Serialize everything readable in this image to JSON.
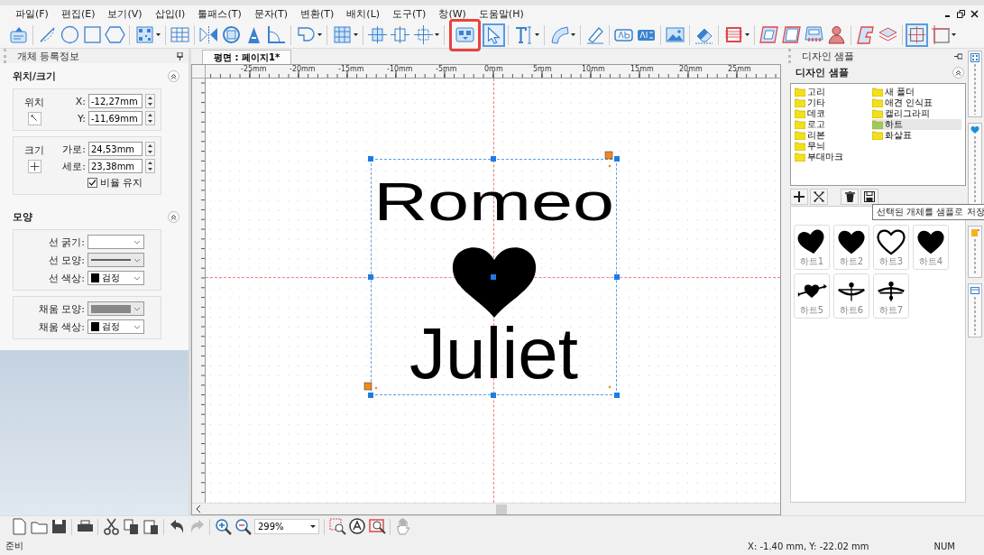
{
  "menu": [
    "파일(F)",
    "편집(E)",
    "보기(V)",
    "삽입(I)",
    "툴패스(T)",
    "문자(T)",
    "변환(T)",
    "배치(L)",
    "도구(T)",
    "창(W)",
    "도움말(H)"
  ],
  "toolbar": [
    {
      "kind": "svg-import",
      "selected": false
    },
    {
      "kind": "separator"
    },
    {
      "kind": "line",
      "selected": false
    },
    {
      "kind": "ellipse",
      "selected": false
    },
    {
      "kind": "rectangle",
      "selected": false
    },
    {
      "kind": "hexagon",
      "selected": false
    },
    {
      "kind": "separator"
    },
    {
      "kind": "qr-code",
      "selected": false,
      "dropdown": true
    },
    {
      "kind": "separator"
    },
    {
      "kind": "table",
      "selected": false
    },
    {
      "kind": "separator"
    },
    {
      "kind": "mirror",
      "selected": false
    },
    {
      "kind": "rotate",
      "selected": false
    },
    {
      "kind": "letter-frame",
      "selected": false
    },
    {
      "kind": "angle",
      "selected": false
    },
    {
      "kind": "separator"
    },
    {
      "kind": "shape",
      "selected": false,
      "dropdown": true
    },
    {
      "kind": "separator"
    },
    {
      "kind": "columns",
      "selected": false,
      "dropdown": true
    },
    {
      "kind": "separator"
    },
    {
      "kind": "align-horizontal",
      "selected": false
    },
    {
      "kind": "align-vertical",
      "selected": false
    },
    {
      "kind": "align-center",
      "selected": false,
      "dropdown": true
    },
    {
      "kind": "separator"
    },
    {
      "kind": "group",
      "selected": false,
      "highlighted": true
    },
    {
      "kind": "pointer",
      "selected": true
    },
    {
      "kind": "separator"
    },
    {
      "kind": "text-cursor",
      "selected": false,
      "dropdown": true
    },
    {
      "kind": "separator"
    },
    {
      "kind": "arc-text",
      "selected": false,
      "dropdown": true
    },
    {
      "kind": "separator"
    },
    {
      "kind": "pen",
      "selected": false
    },
    {
      "kind": "separator"
    },
    {
      "kind": "outline-text",
      "selected": false
    },
    {
      "kind": "fill-text",
      "selected": false
    },
    {
      "kind": "separator"
    },
    {
      "kind": "image",
      "selected": false
    },
    {
      "kind": "separator"
    },
    {
      "kind": "eraser",
      "selected": false
    },
    {
      "kind": "separator"
    },
    {
      "kind": "hatch-frame",
      "selected": false,
      "dropdown": true
    },
    {
      "kind": "separator"
    },
    {
      "kind": "frame-thick",
      "selected": false
    },
    {
      "kind": "frame-thin",
      "selected": false
    },
    {
      "kind": "machine",
      "selected": false
    },
    {
      "kind": "figure",
      "selected": false
    },
    {
      "kind": "separator"
    },
    {
      "kind": "cut-shape",
      "selected": false
    },
    {
      "kind": "layers",
      "selected": false
    },
    {
      "kind": "separator"
    },
    {
      "kind": "crosshair",
      "selected": true
    },
    {
      "kind": "border",
      "selected": false,
      "dropdown": true
    }
  ],
  "properties": {
    "title": "개체 등록정보",
    "position_size": {
      "title": "위치/크기",
      "expanded": true,
      "position": {
        "label": "위치",
        "x_label": "X:",
        "x": "-12,27mm",
        "y_label": "Y:",
        "y": "-11,69mm"
      },
      "size": {
        "label": "크기",
        "width_label": "가로:",
        "width": "24,53mm",
        "height_label": "세로:",
        "height": "23,38mm",
        "keep_ratio": {
          "label": "비율 유지",
          "checked": true
        }
      }
    },
    "shape": {
      "title": "모양",
      "expanded": true,
      "line_width": {
        "label": "선 굵기:"
      },
      "line_style": {
        "label": "선 모양:"
      },
      "line_color": {
        "label": "선 색상:",
        "value": "검정"
      },
      "fill_style": {
        "label": "채움 모양:"
      },
      "fill_color": {
        "label": "채움 색상:",
        "value": "검정"
      }
    }
  },
  "document_tab": {
    "label": "평면 : 페이지1*",
    "selected": true
  },
  "ruler": {
    "labels": [
      "-25mm",
      "-20mm",
      "-15mm",
      "-10mm",
      "-5mm",
      "0mm",
      "5mm",
      "10mm",
      "15mm",
      "20mm",
      "25mm"
    ]
  },
  "canvas": {
    "objects": [
      {
        "kind": "text",
        "text": "Romeo"
      },
      {
        "kind": "heart"
      },
      {
        "kind": "text",
        "text": "Juliet"
      }
    ]
  },
  "samples": {
    "title": "디자인 샘플",
    "section": "디자인 샘플",
    "folders": [
      {
        "label": "고리",
        "selected": false
      },
      {
        "label": "기타",
        "selected": false
      },
      {
        "label": "데코",
        "selected": false
      },
      {
        "label": "로고",
        "selected": false
      },
      {
        "label": "리본",
        "selected": false
      },
      {
        "label": "무늬",
        "selected": false
      },
      {
        "label": "부대마크",
        "selected": false
      },
      {
        "label": "새 폴더",
        "selected": false
      },
      {
        "label": "애견 인식표",
        "selected": false
      },
      {
        "label": "캘리그라피",
        "selected": false
      },
      {
        "label": "하트",
        "selected": true
      },
      {
        "label": "화살표",
        "selected": false
      }
    ],
    "items": [
      {
        "label": "하트1",
        "kind": "tilted-heart"
      },
      {
        "label": "하트2",
        "kind": "heart"
      },
      {
        "label": "하트3",
        "kind": "heart-outline"
      },
      {
        "label": "하트4",
        "kind": "heart"
      },
      {
        "label": "하트5",
        "kind": "arrow-heart"
      },
      {
        "label": "하트6",
        "kind": "bow"
      },
      {
        "label": "하트7",
        "kind": "crossbow"
      }
    ],
    "tooltip": "선택된 개체를 샘플로 저장"
  },
  "bottom_toolbar": [
    {
      "kind": "new-file"
    },
    {
      "kind": "folder"
    },
    {
      "kind": "save"
    },
    {
      "kind": "separator"
    },
    {
      "kind": "print"
    },
    {
      "kind": "separator"
    },
    {
      "kind": "cut"
    },
    {
      "kind": "copy"
    },
    {
      "kind": "paste"
    },
    {
      "kind": "separator"
    },
    {
      "kind": "undo",
      "disabled": false
    },
    {
      "kind": "redo",
      "disabled": true
    },
    {
      "kind": "separator"
    },
    {
      "kind": "zoom-in"
    },
    {
      "kind": "zoom-out"
    },
    {
      "kind": "zoom-field",
      "value": "299%"
    },
    {
      "kind": "separator"
    },
    {
      "kind": "zoom-select"
    },
    {
      "kind": "zoom-letter"
    },
    {
      "kind": "zoom-page"
    },
    {
      "kind": "separator"
    },
    {
      "kind": "hand"
    }
  ],
  "status": {
    "text": "준비",
    "coordinates": "X: -1.40 mm,  Y: -22.02 mm",
    "num": "NUM"
  }
}
